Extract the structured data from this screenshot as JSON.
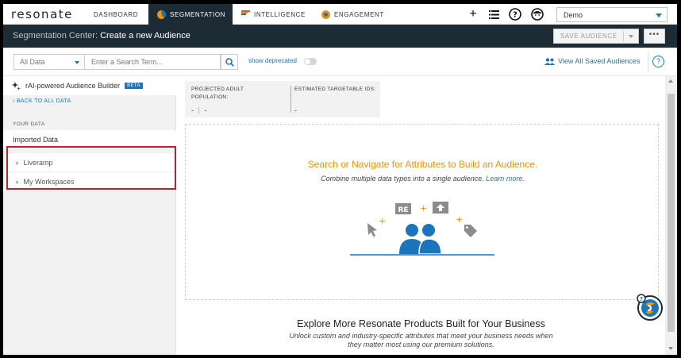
{
  "app": {
    "logo": "resonate"
  },
  "nav": {
    "tabs": [
      {
        "label": "DASHBOARD",
        "icon": "dashboard-grid-icon"
      },
      {
        "label": "SEGMENTATION",
        "icon": "segmentation-icon",
        "active": true
      },
      {
        "label": "INTELLIGENCE",
        "icon": "intelligence-icon"
      },
      {
        "label": "ENGAGEMENT",
        "icon": "engagement-icon"
      }
    ],
    "account_select": "Demo"
  },
  "titlebar": {
    "prefix": "Segmentation Center:",
    "title": "Create a new Audience",
    "save_label": "SAVE AUDIENCE",
    "more_label": "•••"
  },
  "search": {
    "scope_value": "All Data",
    "placeholder": "Enter a Search Term...",
    "deprecated_label": "show deprecated",
    "deprecated_on": false,
    "view_saved_label": "View All Saved Audiences",
    "help_label": "?"
  },
  "sidebar": {
    "builder_label": "rAI-powered Audience Builder",
    "beta_label": "BETA",
    "back_label": "BACK TO ALL DATA",
    "section_label": "YOUR DATA",
    "imported_label": "Imported Data",
    "items": [
      {
        "label": "Liveramp"
      },
      {
        "label": "My Workspaces"
      }
    ]
  },
  "stats": {
    "population_label": "PROJECTED ADULT POPULATION:",
    "population_value": "-",
    "population_value2": "-",
    "ids_label": "ESTIMATED TARGETABLE IDS:",
    "ids_value": "-"
  },
  "dropzone": {
    "title": "Search or Navigate for Attributes to Build an Audience.",
    "subtitle": "Combine multiple data types into a single audience.",
    "learn_more": "Learn more.",
    "re_badge": "RE"
  },
  "explore": {
    "title": "Explore More Resonate Products Built for Your Business",
    "subtitle": "Unlock custom and industry-specific attributes that meet your business needs when they matter most using our premium solutions."
  },
  "colors": {
    "brand_blue": "#1b75bb",
    "brand_orange": "#f39200",
    "header_dark": "#1d2b36",
    "highlight_red": "#c01f2f"
  }
}
